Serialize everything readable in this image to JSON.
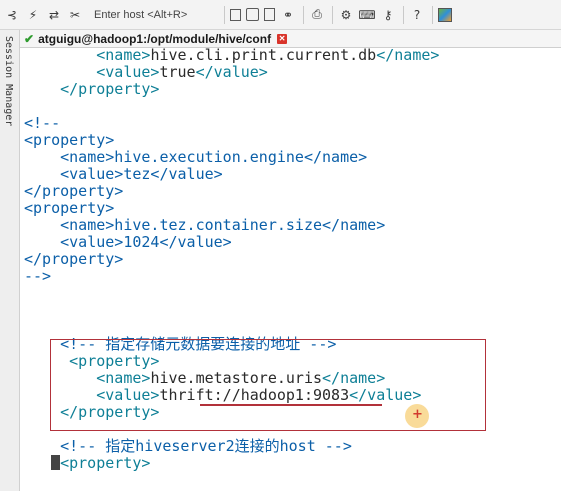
{
  "toolbar": {
    "host_placeholder": "Enter host <Alt+R>"
  },
  "icons": {
    "connect": "connect-icon",
    "lightning": "lightning-icon",
    "reconnect": "reconnect-icon",
    "disconnect": "disconnect-icon",
    "copy": "copy-icon",
    "paste": "paste-icon",
    "clipboard": "clipboard-icon",
    "find": "binoculars-icon",
    "print": "printer-icon",
    "settings": "gear-icon",
    "keymap": "keyboard-icon",
    "sftp": "key-icon",
    "help": "help-icon",
    "app": "app-icon"
  },
  "sidebar": {
    "label": "Session Manager"
  },
  "session": {
    "title": "atguigu@hadoop1:/opt/module/hive/conf"
  },
  "colors": {
    "tag": "#0e7f96",
    "text": "#2a2a2a",
    "comment": "#0b5fa8",
    "highlight_box": "#b2313a"
  },
  "terminal": {
    "lines": [
      {
        "indent": "        ",
        "parts": [
          {
            "c": "teal",
            "t": "<name>"
          },
          {
            "c": "blk",
            "t": "hive.cli.print.current.db"
          },
          {
            "c": "teal",
            "t": "</name>"
          }
        ]
      },
      {
        "indent": "        ",
        "parts": [
          {
            "c": "teal",
            "t": "<value>"
          },
          {
            "c": "blk",
            "t": "true"
          },
          {
            "c": "teal",
            "t": "</value>"
          }
        ]
      },
      {
        "indent": "    ",
        "parts": [
          {
            "c": "teal",
            "t": "</property>"
          }
        ]
      },
      {
        "indent": "",
        "parts": []
      },
      {
        "indent": "",
        "parts": [
          {
            "c": "cmt",
            "t": "<!--"
          }
        ]
      },
      {
        "indent": "",
        "parts": [
          {
            "c": "cmt",
            "t": "<property>"
          }
        ]
      },
      {
        "indent": "    ",
        "parts": [
          {
            "c": "cmt",
            "t": "<name>hive.execution.engine</name>"
          }
        ]
      },
      {
        "indent": "    ",
        "parts": [
          {
            "c": "cmt",
            "t": "<value>tez</value>"
          }
        ]
      },
      {
        "indent": "",
        "parts": [
          {
            "c": "cmt",
            "t": "</property>"
          }
        ]
      },
      {
        "indent": "",
        "parts": [
          {
            "c": "cmt",
            "t": "<property>"
          }
        ]
      },
      {
        "indent": "    ",
        "parts": [
          {
            "c": "cmt",
            "t": "<name>hive.tez.container.size</name>"
          }
        ]
      },
      {
        "indent": "    ",
        "parts": [
          {
            "c": "cmt",
            "t": "<value>1024</value>"
          }
        ]
      },
      {
        "indent": "",
        "parts": [
          {
            "c": "cmt",
            "t": "</property>"
          }
        ]
      },
      {
        "indent": "",
        "parts": [
          {
            "c": "cmt",
            "t": "-->"
          }
        ]
      },
      {
        "indent": "",
        "parts": []
      },
      {
        "indent": "",
        "parts": []
      },
      {
        "indent": "",
        "parts": []
      },
      {
        "indent": "    ",
        "parts": [
          {
            "c": "cmt",
            "t": "<!-- 指定存储元数据要连接的地址 -->"
          }
        ]
      },
      {
        "indent": "     ",
        "parts": [
          {
            "c": "teal",
            "t": "<property>"
          }
        ]
      },
      {
        "indent": "        ",
        "parts": [
          {
            "c": "teal",
            "t": "<name>"
          },
          {
            "c": "blk",
            "t": "hive.metastore.uris"
          },
          {
            "c": "teal",
            "t": "</name>"
          }
        ]
      },
      {
        "indent": "        ",
        "parts": [
          {
            "c": "teal",
            "t": "<value>"
          },
          {
            "c": "blk",
            "t": "thrift://hadoop1:9083"
          },
          {
            "c": "teal",
            "t": "</value>"
          }
        ]
      },
      {
        "indent": "    ",
        "parts": [
          {
            "c": "teal",
            "t": "</property>"
          }
        ]
      },
      {
        "indent": "",
        "parts": []
      },
      {
        "indent": "    ",
        "parts": [
          {
            "c": "cmt",
            "t": "<!-- 指定hiveserver2连接的host -->"
          }
        ]
      },
      {
        "indent": "    ",
        "cursor": true,
        "parts": [
          {
            "c": "teal",
            "t": "<property>"
          }
        ]
      }
    ]
  }
}
